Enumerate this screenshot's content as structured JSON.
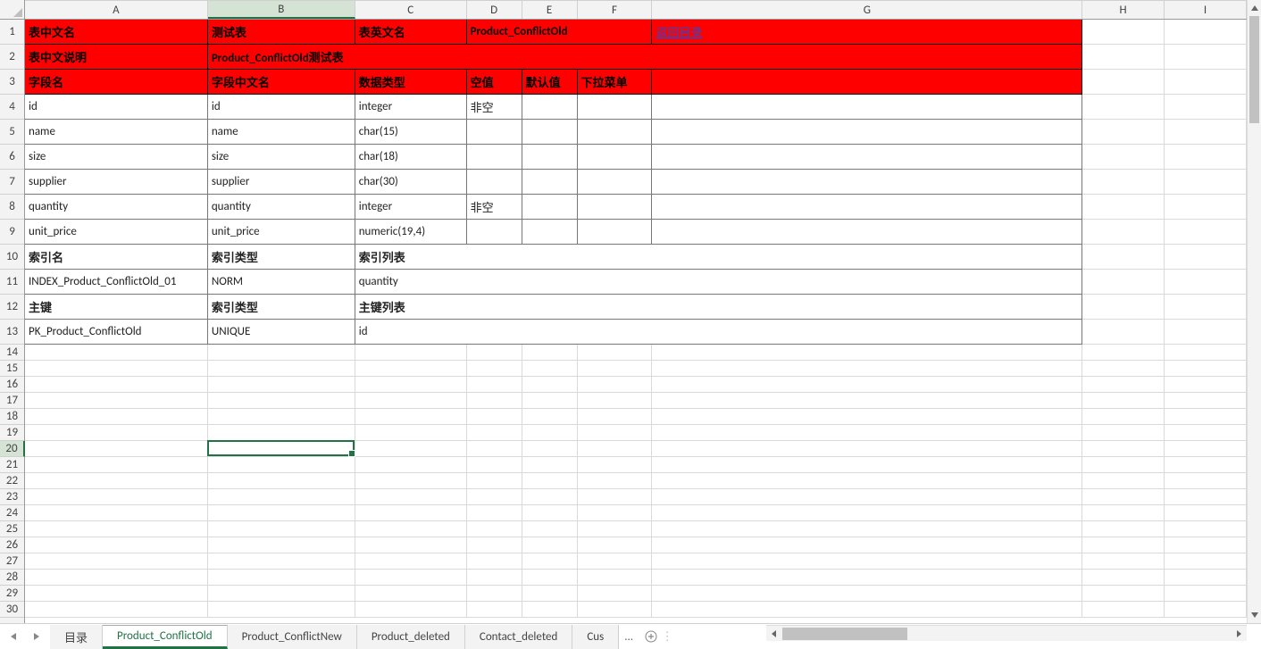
{
  "colWidths": {
    "A": 205,
    "B": 165,
    "C": 125,
    "D": 62,
    "E": 62,
    "F": 84,
    "G": 482,
    "H": 92,
    "I": 92
  },
  "columns": [
    "A",
    "B",
    "C",
    "D",
    "E",
    "F",
    "G",
    "H",
    "I"
  ],
  "rowHeaders": {
    "count": 30,
    "heights": {
      "default": 18,
      "data": 28
    }
  },
  "activeCell": {
    "col": "B",
    "row": 20
  },
  "header1": {
    "A": "表中文名",
    "B": "测试表",
    "C": "表英文名",
    "DEF": "Product_ConflictOld",
    "G_link": "返回目录"
  },
  "header2": {
    "A": "表中文说明",
    "BCDEFG": "Product_ConflictOld测试表"
  },
  "header3": {
    "A": "字段名",
    "B": "字段中文名",
    "C": "数据类型",
    "D": "空值",
    "E": "默认值",
    "F": "下拉菜单",
    "G": ""
  },
  "fields": [
    {
      "A": "id",
      "B": "id",
      "C": "integer",
      "D": "非空",
      "E": "",
      "F": "",
      "G": ""
    },
    {
      "A": "name",
      "B": "name",
      "C": "char(15)",
      "D": "",
      "E": "",
      "F": "",
      "G": ""
    },
    {
      "A": "size",
      "B": "size",
      "C": "char(18)",
      "D": "",
      "E": "",
      "F": "",
      "G": ""
    },
    {
      "A": "supplier",
      "B": "supplier",
      "C": "char(30)",
      "D": "",
      "E": "",
      "F": "",
      "G": ""
    },
    {
      "A": "quantity",
      "B": "quantity",
      "C": "integer",
      "D": "非空",
      "E": "",
      "F": "",
      "G": ""
    },
    {
      "A": "unit_price",
      "B": "unit_price",
      "C": "numeric(19,4)",
      "D": "",
      "E": "",
      "F": "",
      "G": ""
    }
  ],
  "indexHeader": {
    "A": "索引名",
    "B": "索引类型",
    "C": "索引列表"
  },
  "indexRow": {
    "A": "INDEX_Product_ConflictOld_01",
    "B": "NORM",
    "C": "quantity"
  },
  "pkHeader": {
    "A": "主键",
    "B": "索引类型",
    "C": "主键列表"
  },
  "pkRow": {
    "A": "PK_Product_ConflictOld",
    "B": "UNIQUE",
    "C": "id"
  },
  "sheetTabs": [
    "目录",
    "Product_ConflictOld",
    "Product_ConflictNew",
    "Product_deleted",
    "Contact_deleted",
    "Cus"
  ],
  "activeSheet": "Product_ConflictOld",
  "moreIndicator": "...",
  "chart_data": null
}
